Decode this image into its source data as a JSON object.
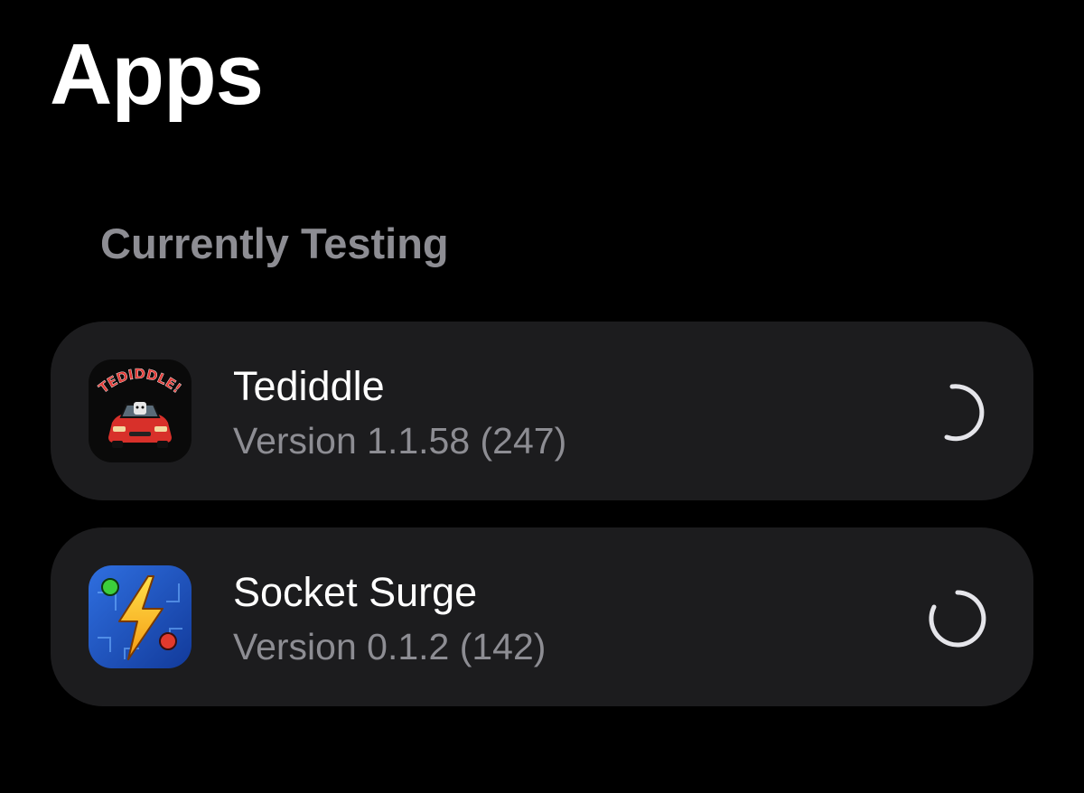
{
  "page": {
    "title": "Apps"
  },
  "section": {
    "header": "Currently Testing"
  },
  "apps": [
    {
      "name": "Tediddle",
      "version": "Version 1.1.58 (247)",
      "icon": "tediddle-app-icon",
      "icon_text": "TEDIDDLE!",
      "status": "loading-spinner"
    },
    {
      "name": "Socket Surge",
      "version": "Version 0.1.2 (142)",
      "icon": "socket-surge-app-icon",
      "status": "loading-spinner"
    }
  ],
  "colors": {
    "background": "#000000",
    "card": "#1c1c1e",
    "primary_text": "#ffffff",
    "secondary_text": "#8d8d93"
  }
}
